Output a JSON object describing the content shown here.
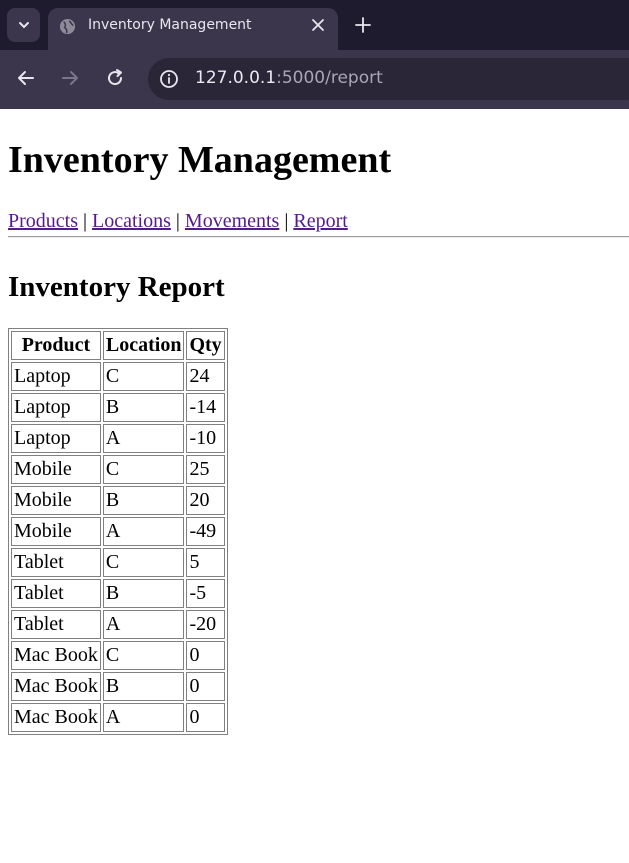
{
  "browser": {
    "tab_title": "Inventory Management",
    "url_host": "127.0.0.1",
    "url_rest": ":5000/report"
  },
  "page": {
    "title": "Inventory Management",
    "nav": [
      "Products",
      "Locations",
      "Movements",
      "Report"
    ],
    "separator": "|",
    "report_title": "Inventory Report"
  },
  "report": {
    "headers": [
      "Product",
      "Location",
      "Qty"
    ],
    "rows": [
      [
        "Laptop",
        "C",
        "24"
      ],
      [
        "Laptop",
        "B",
        "-14"
      ],
      [
        "Laptop",
        "A",
        "-10"
      ],
      [
        "Mobile",
        "C",
        "25"
      ],
      [
        "Mobile",
        "B",
        "20"
      ],
      [
        "Mobile",
        "A",
        "-49"
      ],
      [
        "Tablet",
        "C",
        "5"
      ],
      [
        "Tablet",
        "B",
        "-5"
      ],
      [
        "Tablet",
        "A",
        "-20"
      ],
      [
        "Mac Book",
        "C",
        "0"
      ],
      [
        "Mac Book",
        "B",
        "0"
      ],
      [
        "Mac Book",
        "A",
        "0"
      ]
    ]
  },
  "colors": {
    "link_visited": "#551a8b",
    "browser_frame": "#1f1b2e",
    "browser_toolbar": "#3b364c"
  }
}
